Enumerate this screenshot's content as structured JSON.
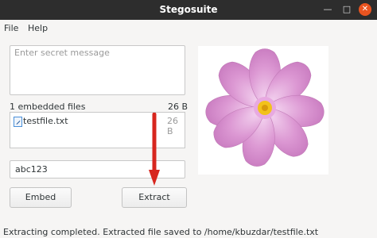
{
  "window": {
    "title": "Stegosuite"
  },
  "window_controls": {
    "minimize": "—",
    "maximize": "□",
    "close": "✕"
  },
  "menu": {
    "file": "File",
    "help": "Help"
  },
  "message": {
    "placeholder": "Enter secret message"
  },
  "embedded_files": {
    "label": "1 embedded files",
    "total_size": "26 B",
    "items": [
      {
        "name": "testfile.txt",
        "size": "26 B"
      }
    ]
  },
  "password": {
    "value": "abc123"
  },
  "buttons": {
    "embed": "Embed",
    "extract": "Extract"
  },
  "status": {
    "text": "Extracting completed. Extracted file saved to /home/kbuzdar/testfile.txt"
  },
  "image": {
    "subject": "pink cosmos flower",
    "petal_color": "#d98fd0",
    "petal_light": "#f0c8ec",
    "center_color": "#f2c21b"
  },
  "annotation": {
    "arrow_color": "#d7261e"
  }
}
